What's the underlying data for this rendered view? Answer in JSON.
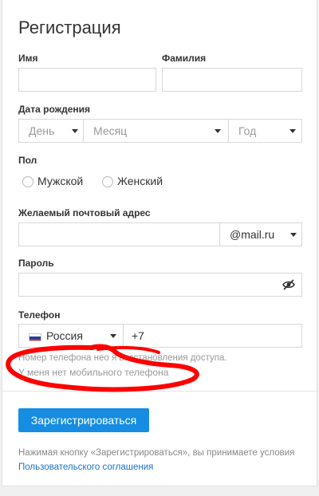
{
  "title": "Регистрация",
  "fields": {
    "first_name": {
      "label": "Имя",
      "value": ""
    },
    "last_name": {
      "label": "Фамилия",
      "value": ""
    },
    "birth_date": {
      "label": "Дата рождения",
      "day": "День",
      "month": "Месяц",
      "year": "Год"
    },
    "gender": {
      "label": "Пол",
      "male": "Мужской",
      "female": "Женский"
    },
    "email": {
      "label": "Желаемый почтовый адрес",
      "domain": "@mail.ru",
      "value": ""
    },
    "password": {
      "label": "Пароль",
      "value": "",
      "toggle_icon": "eye-off-icon"
    },
    "phone": {
      "label": "Телефон",
      "country": "Россия",
      "code": "+7",
      "hint": "Номер телефона нео      я восстановления доступа.",
      "no_phone_link": "У меня нет мобильного телефона"
    }
  },
  "submit": {
    "label": "Зарегистрироваться"
  },
  "footer": {
    "text_prefix": "Нажимая кнопку «Зарегистрироваться», вы принимаете условия ",
    "link": "Пользовательского соглашения"
  },
  "colors": {
    "accent": "#168de2",
    "link": "#1a73c4",
    "annotation": "#ff0000"
  }
}
